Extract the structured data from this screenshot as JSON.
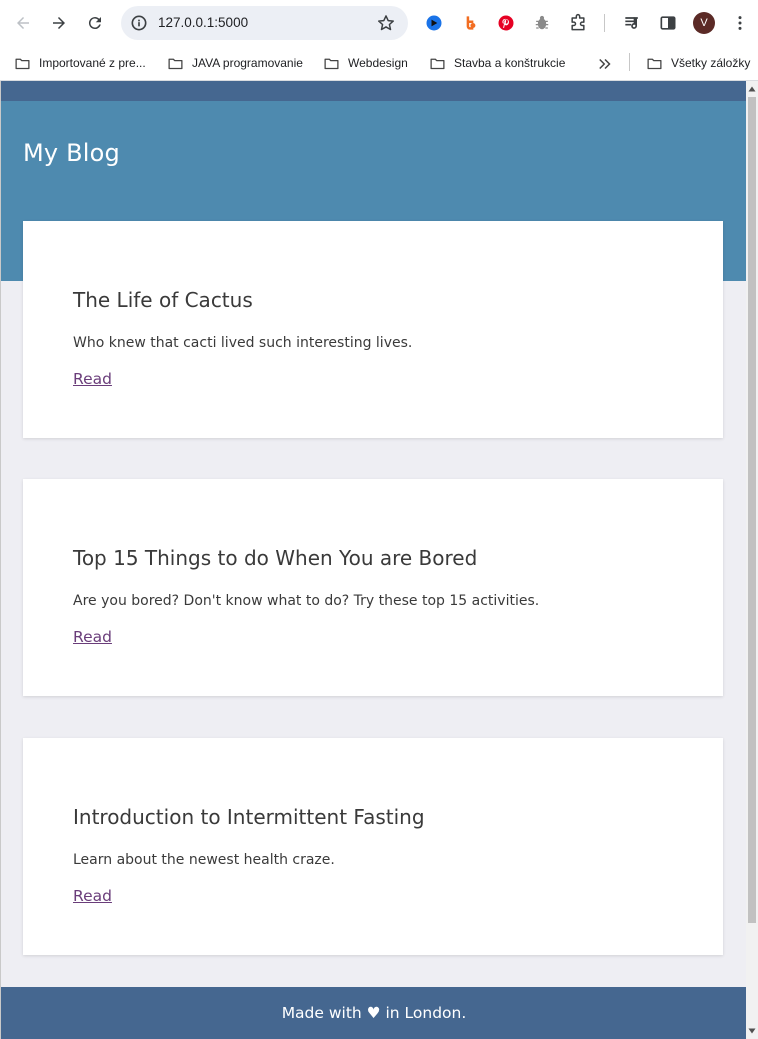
{
  "browser": {
    "url": "127.0.0.1:5000",
    "avatar_letter": "V",
    "bookmarks": [
      {
        "label": "Importované z pre..."
      },
      {
        "label": "JAVA programovanie"
      },
      {
        "label": "Webdesign"
      },
      {
        "label": "Stavba a konštrukcie"
      },
      {
        "label": "Všetky záložky"
      }
    ]
  },
  "page": {
    "site_title": "My Blog",
    "posts": [
      {
        "title": "The Life of Cactus",
        "subtitle": "Who knew that cacti lived such interesting lives.",
        "link": "Read"
      },
      {
        "title": "Top 15 Things to do When You are Bored",
        "subtitle": "Are you bored? Don't know what to do? Try these top 15 activities.",
        "link": "Read"
      },
      {
        "title": "Introduction to Intermittent Fasting",
        "subtitle": "Learn about the newest health craze.",
        "link": "Read"
      }
    ],
    "footer": "Made with ♥ in London."
  },
  "colors": {
    "header_dark": "#456790",
    "hero": "#4e8aaf",
    "page_bg": "#eeeef3",
    "link": "#6a3d7a"
  }
}
